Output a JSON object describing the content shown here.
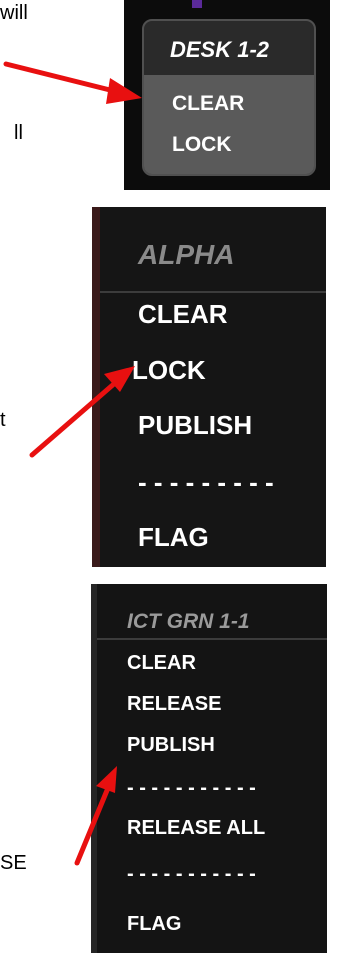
{
  "doc_fragments": [
    "will",
    "ll",
    "t",
    "SE"
  ],
  "menus": [
    {
      "title": "DESK 1-2",
      "items": [
        "CLEAR",
        "LOCK"
      ]
    },
    {
      "title": "ALPHA",
      "items": [
        "CLEAR",
        "LOCK",
        "PUBLISH",
        "- - - - - - - - -",
        "FLAG"
      ]
    },
    {
      "title": "ICT GRN 1-1",
      "items": [
        "CLEAR",
        "RELEASE",
        "PUBLISH",
        "- - - - - - - - - - -",
        "RELEASE ALL",
        "- - - - - - - - - - -",
        "FLAG"
      ]
    }
  ],
  "colors": {
    "arrow": "#e81010",
    "menu_bg": "#161616",
    "highlight": "#5a5a5a"
  }
}
